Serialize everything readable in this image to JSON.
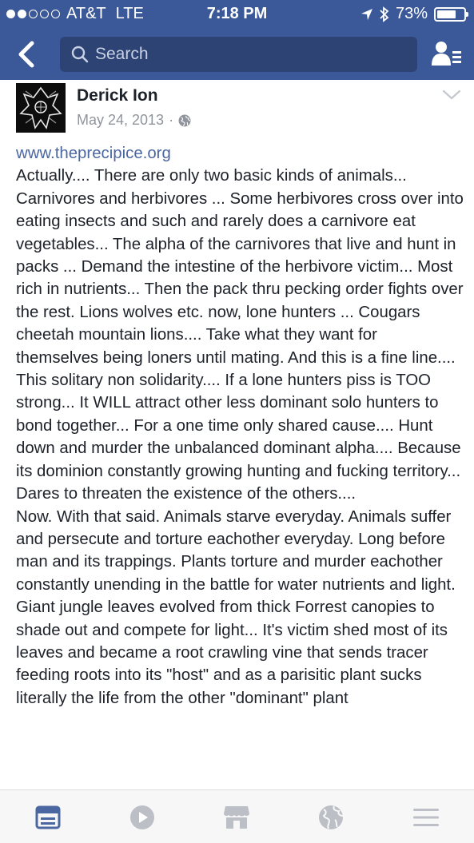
{
  "status_bar": {
    "carrier": "AT&T",
    "network": "LTE",
    "time": "7:18 PM",
    "battery_percent": "73%",
    "battery_level": 0.73
  },
  "nav": {
    "search_placeholder": "Search"
  },
  "post": {
    "author": "Derick Ion",
    "date": "May 24, 2013",
    "link": "www.theprecipice.org",
    "paragraphs": [
      "Actually.... There are only two basic kinds of animals... Carnivores and herbivores ... Some herbivores cross over into eating insects and such and rarely does a carnivore eat vegetables... The alpha of the carnivores that live and hunt in packs ... Demand the intestine of the herbivore victim... Most rich in nutrients... Then the pack thru pecking order fights over the rest. Lions wolves etc. now, lone hunters ... Cougars cheetah mountain lions.... Take what they want for themselves being loners until mating. And this is a fine line.... This solitary non solidarity.... If a lone hunters piss is TOO strong... It WILL attract other less dominant solo hunters to bond together... For a one time only shared cause.... Hunt down and murder the unbalanced dominant alpha.... Because its dominion constantly growing hunting and fucking territory... Dares to threaten the existence of the others....",
      "Now. With that said. Animals starve everyday. Animals suffer and persecute and torture eachother everyday. Long before man and its trappings. Plants torture and murder eachother constantly unending in the battle for water nutrients and light. Giant jungle leaves evolved from thick Forrest canopies to shade out and compete for light... It's victim shed most of its leaves and became a root crawling vine that sends tracer feeding roots into its \"host\" and as a parisitic plant sucks literally the life from the other \"dominant\" plant"
    ]
  },
  "colors": {
    "header": "#3b5998",
    "link": "#4b67a1",
    "tab_active": "#4b67a1",
    "tab_inactive": "#bcc0c6"
  },
  "icons": {
    "back": "chevron-left-icon",
    "search": "search-icon",
    "friends": "friend-requests-icon",
    "globe": "globe-icon",
    "tabs": [
      "news-feed-icon",
      "video-icon",
      "marketplace-icon",
      "notifications-globe-icon",
      "menu-icon"
    ]
  }
}
